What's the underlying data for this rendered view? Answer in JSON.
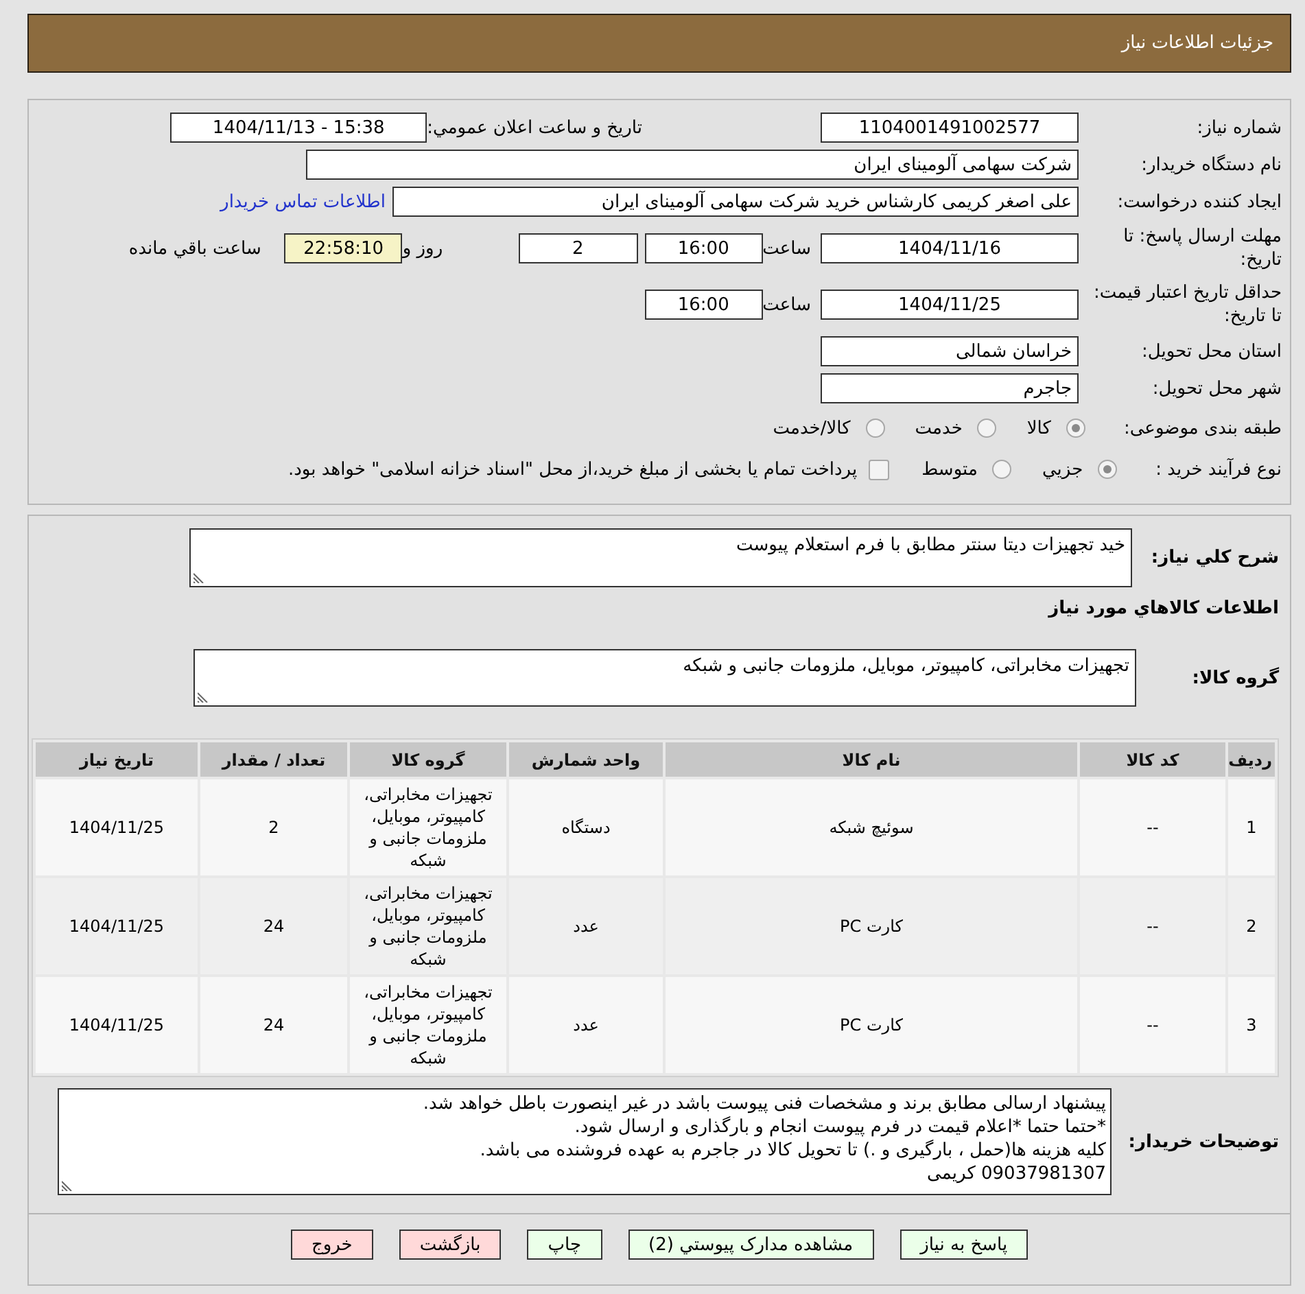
{
  "header": {
    "title": "جزئیات اطلاعات نیاز"
  },
  "details": {
    "need_number": {
      "label": "شماره نیاز:",
      "value": "1104001491002577"
    },
    "announcement": {
      "label": "تاریخ و ساعت اعلان عمومي:",
      "value": "1404/11/13 - 15:38"
    },
    "buyer_organization": {
      "label": "نام دستگاه خریدار:",
      "value": "شرکت سهامی آلومینای ایران"
    },
    "requester": {
      "label": "ایجاد کننده درخواست:",
      "value": "علی اصغر کریمی کارشناس خرید شرکت سهامی آلومینای ایران",
      "contact_link": "اطلاعات تماس خریدار"
    },
    "reply_deadline": {
      "label": "مهلت ارسال پاسخ: تا تاریخ:",
      "date": "1404/11/16",
      "time_label": "ساعت",
      "time": "16:00",
      "days": "2",
      "days_label": "روز و",
      "remaining": "22:58:10",
      "remaining_label": "ساعت باقي مانده"
    },
    "price_validity": {
      "label": "حداقل تاریخ اعتبار قیمت: تا تاریخ:",
      "date": "1404/11/25",
      "time_label": "ساعت",
      "time": "16:00"
    },
    "delivery_province": {
      "label": "استان محل تحویل:",
      "value": "خراسان شمالی"
    },
    "delivery_city": {
      "label": "شهر محل تحویل:",
      "value": "جاجرم"
    },
    "category": {
      "label": "طبقه بندی موضوعی:",
      "options": [
        {
          "label": "کالا",
          "selected": true
        },
        {
          "label": "خدمت",
          "selected": false
        },
        {
          "label": "کالا/خدمت",
          "selected": false
        }
      ]
    },
    "purchase_process": {
      "label": "نوع فرآیند خرید :",
      "options": [
        {
          "label": "جزيي",
          "selected": true
        },
        {
          "label": "متوسط",
          "selected": false
        }
      ],
      "treasury_payment": {
        "checked": false,
        "text": "پرداخت تمام یا بخشی از مبلغ خرید،از محل \"اسناد خزانه اسلامی\" خواهد بود."
      }
    }
  },
  "need": {
    "description": {
      "label": "شرح كلي نياز:",
      "value": "خید تجهیزات دیتا سنتر مطابق با فرم استعلام پیوست"
    },
    "items_title": "اطلاعات كالاهاي مورد نياز",
    "goods_group": {
      "label": "گروه کالا:",
      "value": "تجهیزات مخابراتی، کامپیوتر، موبایل، ملزومات جانبی و شبکه"
    },
    "table": {
      "columns": [
        "ردیف",
        "کد کالا",
        "نام کالا",
        "واحد شمارش",
        "گروه کالا",
        "تعداد / مقدار",
        "تاریخ نیاز"
      ],
      "rows": [
        [
          "1",
          "--",
          "سوئیچ شبکه",
          "دستگاه",
          "تجهیزات مخابراتی، کامپیوتر، موبایل، ملزومات جانبی و شبکه",
          "2",
          "1404/11/25"
        ],
        [
          "2",
          "--",
          "کارت PC",
          "عدد",
          "تجهیزات مخابراتی، کامپیوتر، موبایل، ملزومات جانبی و شبکه",
          "24",
          "1404/11/25"
        ],
        [
          "3",
          "--",
          "کارت PC",
          "عدد",
          "تجهیزات مخابراتی، کامپیوتر، موبایل، ملزومات جانبی و شبکه",
          "24",
          "1404/11/25"
        ]
      ]
    },
    "buyer_notes": {
      "label": "توضیحات خریدار:",
      "value": "پیشنهاد ارسالی مطابق برند و مشخصات فنی پیوست باشد در غیر اینصورت باطل خواهد شد.\n*حتما حتما *اعلام قیمت در فرم پیوست انجام و بارگذاری و ارسال شود.\nکلیه هزینه ها(حمل ، بارگیری و .) تا تحویل کالا در جاجرم به عهده فروشنده می باشد.\n09037981307 کریمی"
    }
  },
  "buttons": [
    {
      "label": "پاسخ به نیاز",
      "kind": "reply"
    },
    {
      "label": "مشاهده مدارک پیوستي (2)",
      "kind": "attachments"
    },
    {
      "label": "چاپ",
      "kind": "print"
    },
    {
      "label": "بازگشت",
      "kind": "back"
    },
    {
      "label": "خروج",
      "kind": "exit"
    }
  ]
}
